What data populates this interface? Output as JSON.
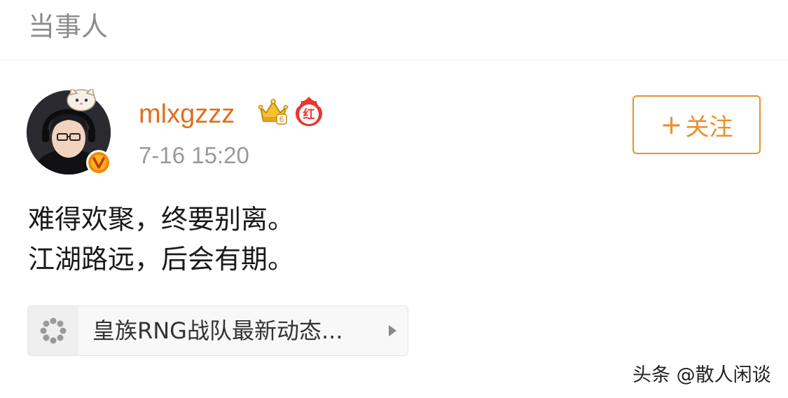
{
  "header": {
    "title": "当事人"
  },
  "post": {
    "username": "mlxgzzz",
    "time": "7-16 15:20",
    "badges": {
      "crown_icon": "crown-level-6-icon",
      "crown_level": "6",
      "hot_icon": "hot-red-flame-icon",
      "hot_label": "红"
    },
    "verified_icon": "verified-v-icon",
    "verified_label": "V",
    "follow_button": {
      "plus": "+",
      "label": "关注"
    },
    "body_lines": [
      "难得欢聚，终要别离。",
      "江湖路远，后会有期。"
    ],
    "topic": {
      "icon": "loading-spinner-icon",
      "label": "皇族RNG战队最新动态..."
    }
  },
  "watermark": "头条 @散人闲谈",
  "colors": {
    "username": "#e0701c",
    "follow_accent": "#e8902e",
    "muted_text": "#999999",
    "header_text": "#8c8c8c",
    "verified": "#f28a00"
  }
}
